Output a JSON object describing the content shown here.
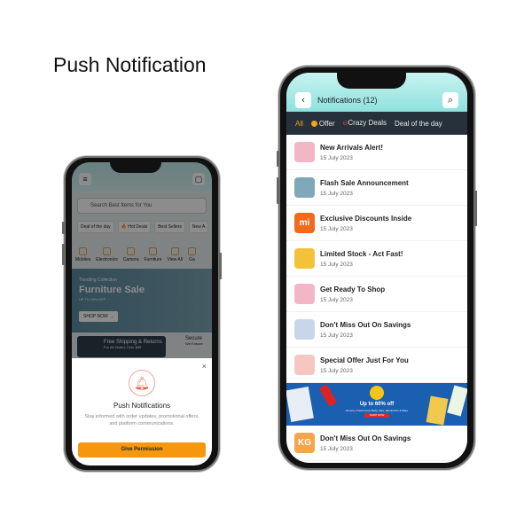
{
  "page_title": "Push Notification",
  "left_phone": {
    "search_placeholder": "Search Best Items for You",
    "chips": [
      "Deal of the day",
      "🔥 Hot Deals",
      "Best Sellers",
      "New A"
    ],
    "categories": [
      "Mobiles",
      "Electronics",
      "Camera",
      "Furniture",
      "View All",
      "Ga"
    ],
    "banner": {
      "kicker": "Trending Collection",
      "title": "Furniture Sale",
      "subtitle": "UP TO 25% OFF",
      "button": "SHOP NOW →"
    },
    "shipping": "Free Shipping & Returns",
    "shipping_sub": "For All Orders Over $99",
    "secure": "Secure",
    "secure_sub": "We Ensure",
    "sheet": {
      "close": "×",
      "title": "Push Notifications",
      "description": "Stay informed with order updates, promotional offers, and platform communications.",
      "button": "Give Permission"
    }
  },
  "right_phone": {
    "title": "Notifications (12)",
    "tabs": [
      "All",
      "Offer",
      "Crazy Deals",
      "Deal of the day"
    ],
    "items": [
      {
        "title": "New Arrivals Alert!",
        "date": "15 July 2023",
        "avatar_color": "#f3b6c6"
      },
      {
        "title": "Flash Sale Announcement",
        "date": "15 July 2023",
        "avatar_color": "#7fa9b8"
      },
      {
        "title": "Exclusive Discounts Inside",
        "date": "15 July 2023",
        "avatar_color": "#f26b1d",
        "avatar_text": "mi"
      },
      {
        "title": "Limited Stock - Act Fast!",
        "date": "15 July 2023",
        "avatar_color": "#f4c23a"
      },
      {
        "title": "Get Ready To Shop",
        "date": "15 July 2023",
        "avatar_color": "#f3b6c6"
      },
      {
        "title": "Don't Miss Out On Savings",
        "date": "15 July 2023",
        "avatar_color": "#c9d6ea",
        "avatar_text": ""
      },
      {
        "title": "Special Offer Just For You",
        "date": "15 July 2023",
        "avatar_color": "#f6c6c0"
      }
    ],
    "promo": {
      "headline": "Up to 60% off",
      "sub": "Grocery, Fresh Food, Baby Care, Electronics & More",
      "button": "SHOP NOW"
    },
    "last_item": {
      "title": "Don't Miss Out On Savings",
      "date": "15 July 2023",
      "avatar_text": "KG",
      "avatar_color": "#f7a54a"
    }
  }
}
